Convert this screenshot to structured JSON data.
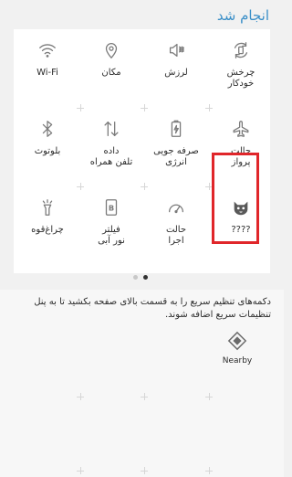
{
  "header": {
    "done_label": "انجام شد"
  },
  "tiles": [
    {
      "label": "چرخش\nخودکار",
      "icon": "auto-rotate-icon"
    },
    {
      "label": "لرزش",
      "icon": "vibrate-icon"
    },
    {
      "label": "مکان",
      "icon": "location-icon"
    },
    {
      "label": "Wi-Fi",
      "icon": "wifi-icon"
    },
    {
      "label": "حالت\nپرواز",
      "icon": "airplane-icon"
    },
    {
      "label": "صرفه جویی\nانرژی",
      "icon": "battery-saver-icon"
    },
    {
      "label": "داده\nتلفن همراه",
      "icon": "mobile-data-icon"
    },
    {
      "label": "بلوتوث",
      "icon": "bluetooth-icon"
    },
    {
      "label": "چراغ‌قوه",
      "icon": "flashlight-icon"
    },
    {
      "label": "فیلتر\nنور آبی",
      "icon": "blue-light-filter-icon"
    },
    {
      "label": "حالت\nاجرا",
      "icon": "performance-mode-icon"
    },
    {
      "label": "????",
      "icon": "cat-face-icon"
    }
  ],
  "instructions": "دکمه‌های تنظیم سریع را به قسمت بالای صفحه بکشید تا به پنل تنظیمات سریع اضافه شوند.",
  "available": [
    {
      "label": "Nearby",
      "icon": "nearby-icon"
    }
  ],
  "colors": {
    "accent": "#3a8fc8",
    "highlight": "#e0262a",
    "icon": "#7a7a7a"
  }
}
